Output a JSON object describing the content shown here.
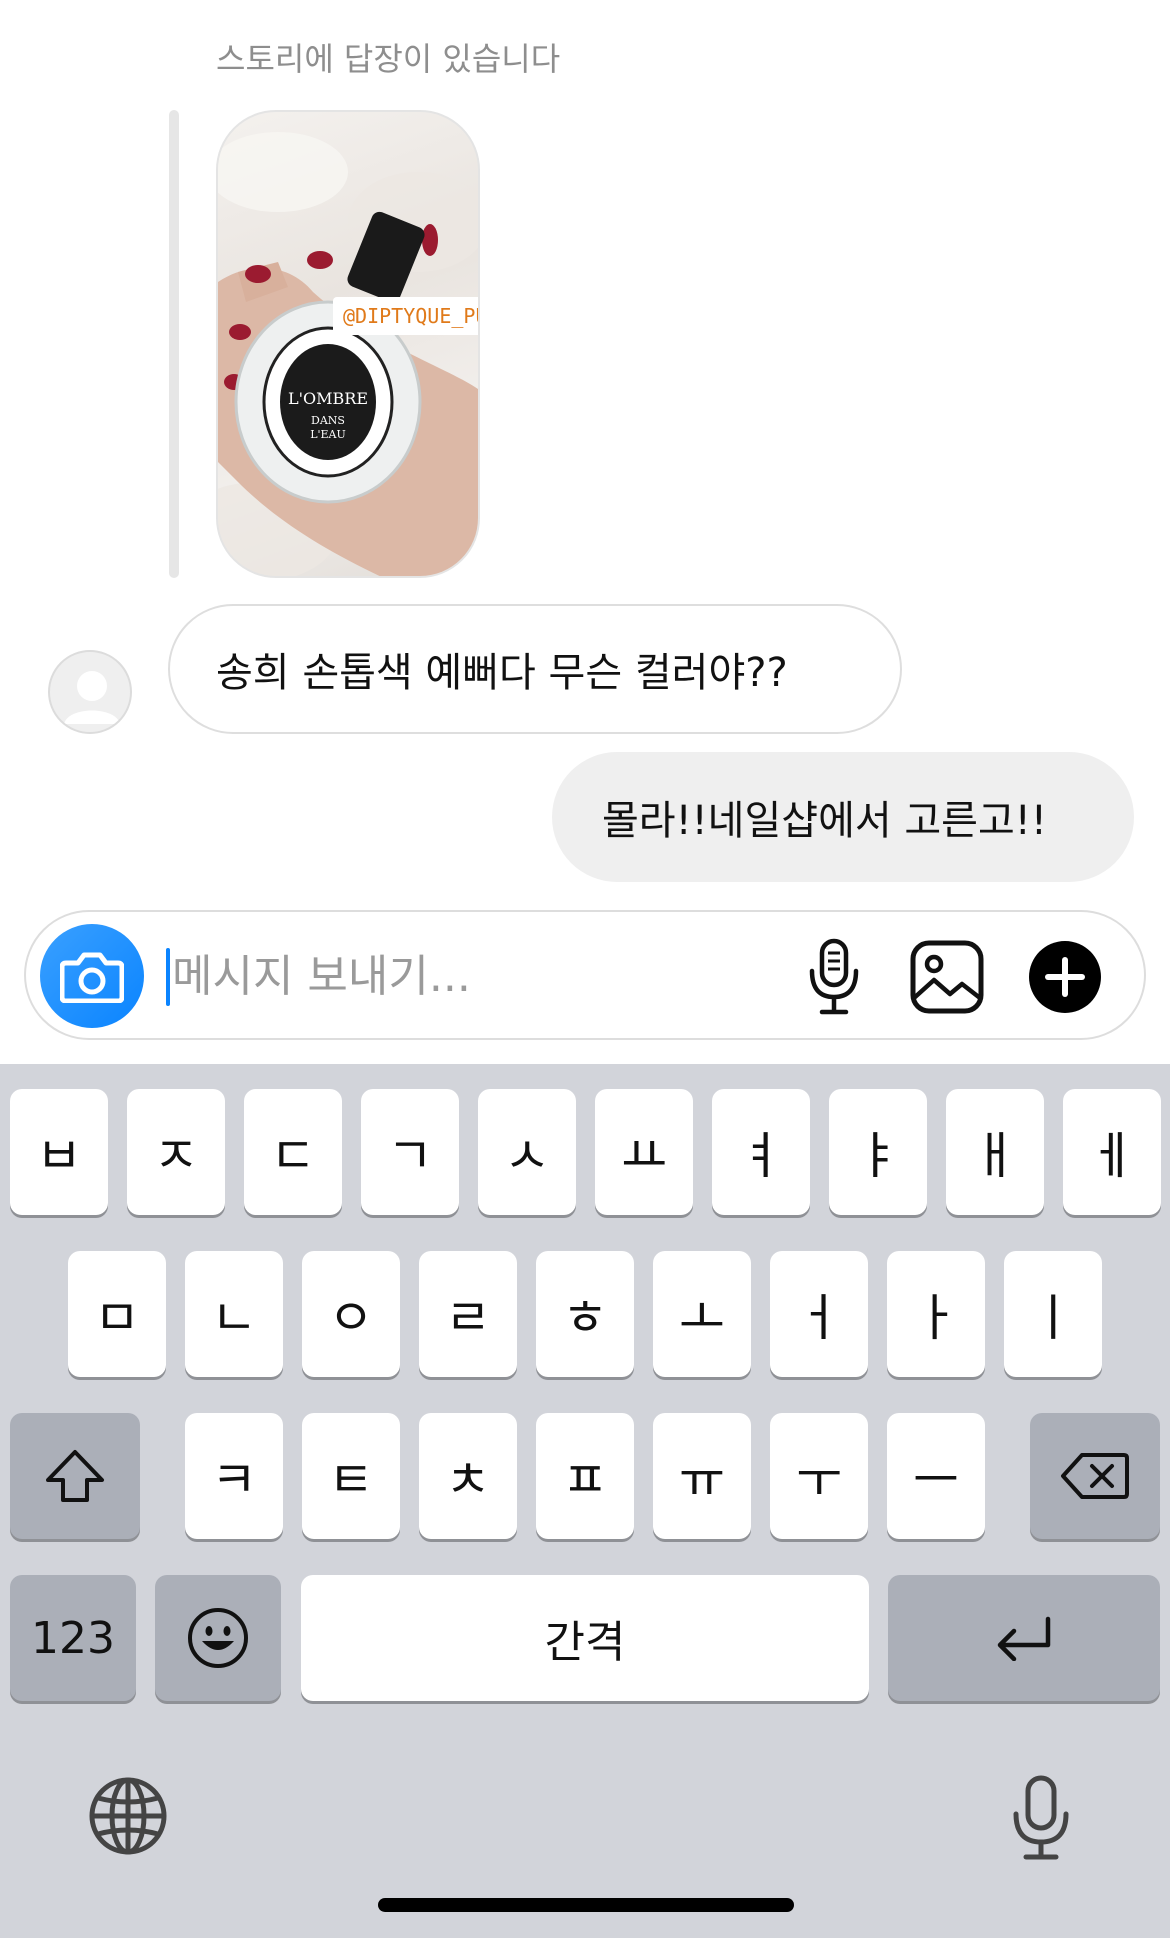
{
  "chat": {
    "story_caption": "스토리에 답장이 있습니다",
    "story_tag": "@DIPTYQUE_PUF",
    "messages": [
      {
        "sender": "other",
        "text": "송희 손톱색 예뻐다 무슨 컬러야??"
      },
      {
        "sender": "me",
        "text": "몰라!!네일샵에서 고른고!!"
      }
    ]
  },
  "composer": {
    "placeholder": "메시지 보내기...",
    "value": ""
  },
  "icons": {
    "camera": "camera-icon",
    "mic": "microphone-icon",
    "gallery": "image-gallery-icon",
    "plus": "plus-circle-icon",
    "shift": "shift-arrow-icon",
    "backspace": "backspace-icon",
    "emoji": "emoji-face-icon",
    "return": "return-arrow-icon",
    "globe": "globe-icon",
    "dictation": "dictation-mic-icon"
  },
  "keyboard": {
    "row1": [
      "ㅂ",
      "ㅈ",
      "ㄷ",
      "ㄱ",
      "ㅅ",
      "ㅛ",
      "ㅕ",
      "ㅑ",
      "ㅐ",
      "ㅔ"
    ],
    "row2": [
      "ㅁ",
      "ㄴ",
      "ㅇ",
      "ㄹ",
      "ㅎ",
      "ㅗ",
      "ㅓ",
      "ㅏ",
      "ㅣ"
    ],
    "row3": [
      "ㅋ",
      "ㅌ",
      "ㅊ",
      "ㅍ",
      "ㅠ",
      "ㅜ",
      "ㅡ"
    ],
    "numbers_label": "123",
    "space_label": "간격"
  },
  "colors": {
    "accent": "#0a84ff",
    "keyboard_bg": "#d2d4da",
    "key_gray": "#abafb8",
    "bubble_out": "#efefef"
  }
}
